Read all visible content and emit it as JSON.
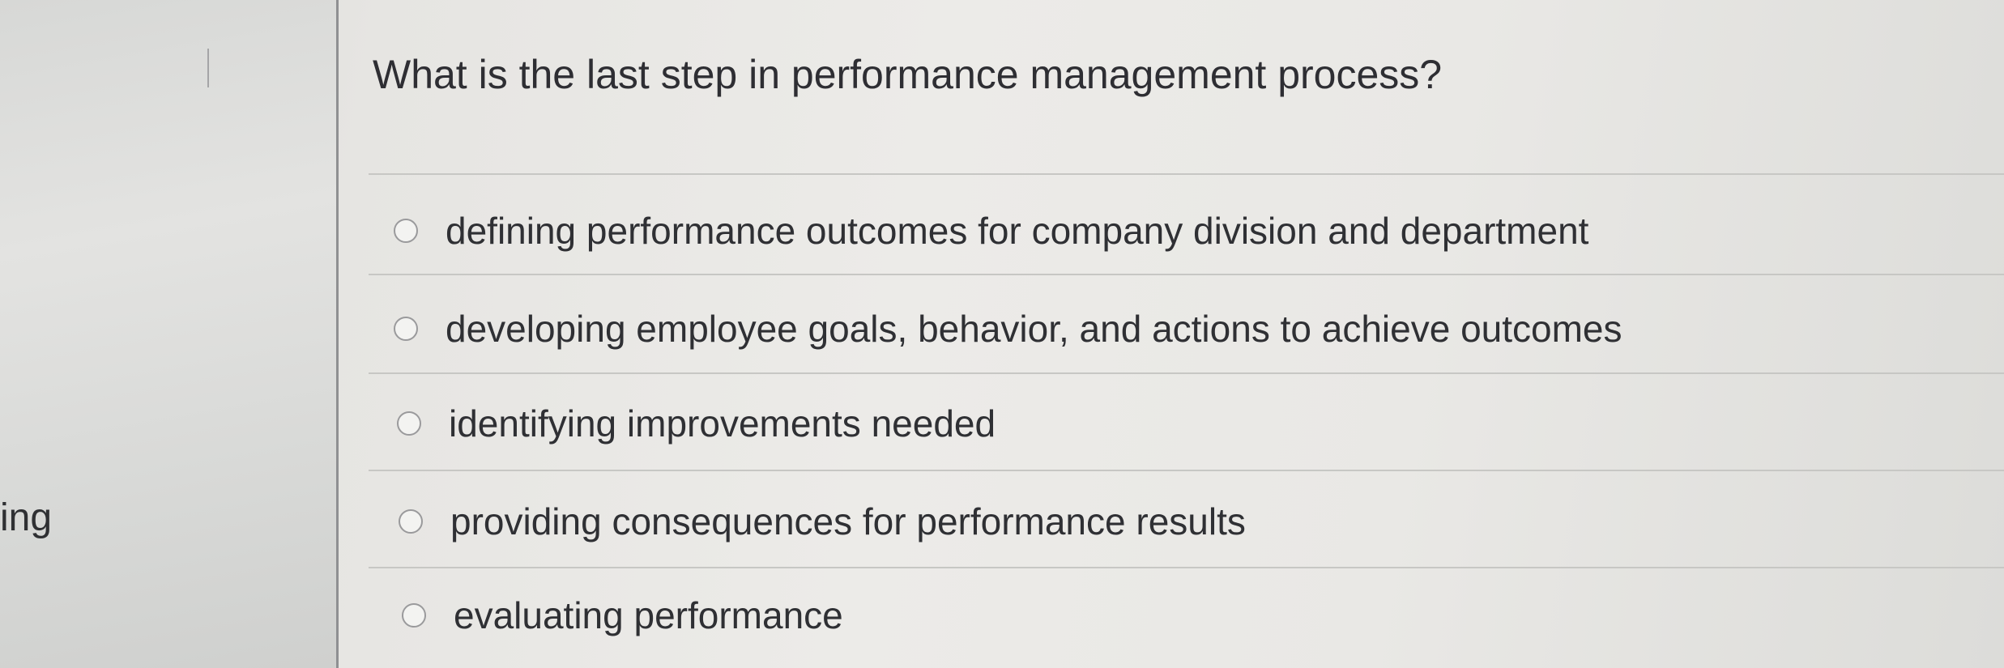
{
  "question": {
    "text": "What is the last step in performance management process?"
  },
  "options": [
    {
      "label": "defining performance outcomes for company division and department",
      "selected": false
    },
    {
      "label": "developing employee goals, behavior, and actions to achieve outcomes",
      "selected": false
    },
    {
      "label": "identifying improvements needed",
      "selected": false
    },
    {
      "label": "providing consequences for performance results",
      "selected": false
    },
    {
      "label": "evaluating performance",
      "selected": false
    }
  ],
  "left_panel": {
    "partial_text": "ing"
  }
}
